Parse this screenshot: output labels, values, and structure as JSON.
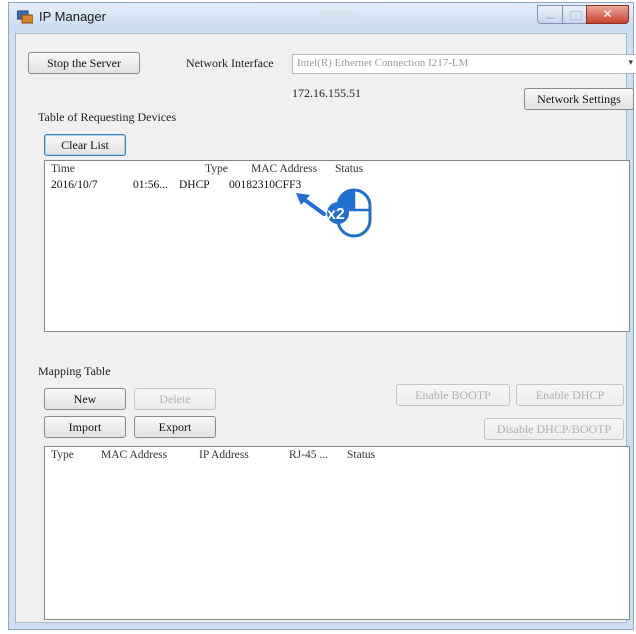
{
  "window": {
    "title": "IP Manager"
  },
  "top": {
    "stop_server_label": "Stop the Server",
    "network_interface_label": "Network Interface",
    "network_interface_value": "Intel(R) Ethernet Connection I217-LM",
    "ip_address": "172.16.155.51",
    "network_settings_label": "Network Settings"
  },
  "requests": {
    "section_label": "Table of Requesting Devices",
    "clear_list_label": "Clear List",
    "columns": [
      "Time",
      "Type",
      "MAC Address",
      "Status"
    ],
    "rows": [
      {
        "date": "2016/10/7",
        "time": "01:56...",
        "type": "DHCP",
        "mac": "00182310CFF3",
        "status": ""
      }
    ]
  },
  "annotation": {
    "double_click_text": "x2",
    "arrow_color": "#1f6fd1",
    "mouse_color": "#1f6fd1"
  },
  "mapping": {
    "section_label": "Mapping Table",
    "new_label": "New",
    "delete_label": "Delete",
    "import_label": "Import",
    "export_label": "Export",
    "enable_bootp_label": "Enable BOOTP",
    "enable_dhcp_label": "Enable DHCP",
    "disable_label": "Disable DHCP/BOOTP",
    "columns": [
      "Type",
      "MAC Address",
      "IP Address",
      "RJ-45 ...",
      "Status"
    ]
  }
}
